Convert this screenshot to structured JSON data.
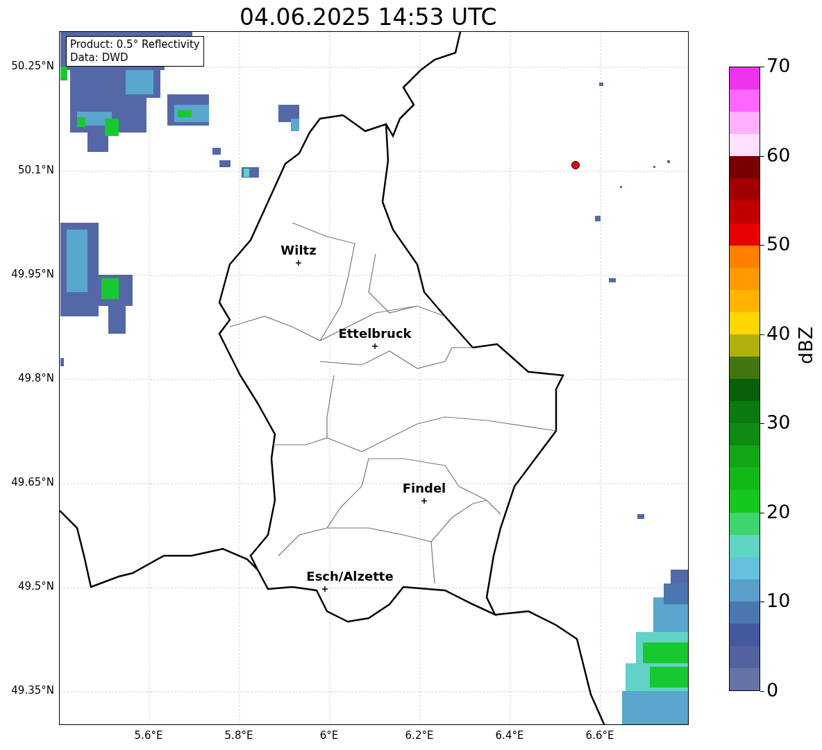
{
  "title": "04.06.2025 14:53 UTC",
  "info_box": [
    "Product: 0.5° Reflectivity",
    "Data: DWD"
  ],
  "lat_labels": [
    "50.25°N",
    "50.1°N",
    "49.95°N",
    "49.8°N",
    "49.65°N",
    "49.5°N",
    "49.35°N"
  ],
  "lon_labels": [
    "5.6°E",
    "5.8°E",
    "6°E",
    "6.2°E",
    "6.4°E",
    "6.6°E"
  ],
  "cities": [
    {
      "name": "Wiltz"
    },
    {
      "name": "Ettelbruck"
    },
    {
      "name": "Findel"
    },
    {
      "name": "Esch/Alzette"
    }
  ],
  "radar_site": {
    "color": "#e8000b"
  },
  "colorbar": {
    "label": "dBZ",
    "ticks": [
      "70",
      "60",
      "50",
      "40",
      "30",
      "20",
      "10",
      "0"
    ],
    "segments": [
      {
        "color": "#ee33ee"
      },
      {
        "color": "#ff66ff"
      },
      {
        "color": "#ffb0ff"
      },
      {
        "color": "#ffe0ff"
      },
      {
        "color": "#780000"
      },
      {
        "color": "#a00000"
      },
      {
        "color": "#c00000"
      },
      {
        "color": "#e60000"
      },
      {
        "color": "#ff7f00"
      },
      {
        "color": "#ff9a00"
      },
      {
        "color": "#ffb300"
      },
      {
        "color": "#ffd700"
      },
      {
        "color": "#b0b00a"
      },
      {
        "color": "#437510"
      },
      {
        "color": "#08600c"
      },
      {
        "color": "#0b7a10"
      },
      {
        "color": "#0f8a12"
      },
      {
        "color": "#12a514"
      },
      {
        "color": "#12b818"
      },
      {
        "color": "#14c81e"
      },
      {
        "color": "#3ed46e"
      },
      {
        "color": "#5fd6c4"
      },
      {
        "color": "#66c2dc"
      },
      {
        "color": "#5a9fc8"
      },
      {
        "color": "#4a77b0"
      },
      {
        "color": "#43589e"
      },
      {
        "color": "#52639d"
      },
      {
        "color": "#6673a6"
      }
    ]
  }
}
